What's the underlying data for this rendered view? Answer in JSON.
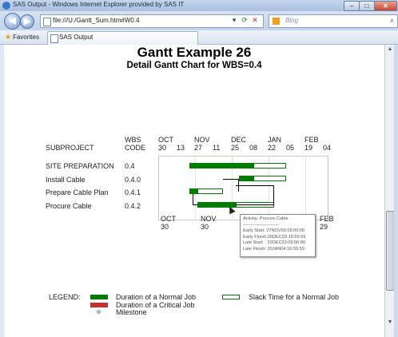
{
  "window": {
    "title": "SAS Output - Windows Internet Explorer provided by SAS IT",
    "minimize": "–",
    "maximize": "□",
    "close": "✕"
  },
  "nav": {
    "url": "file:///U:/Gantt_Sum.htm#W0.4",
    "search_placeholder": "Bing",
    "back": "◀",
    "forward": "▶",
    "refresh": "⟳",
    "stop": "✕",
    "dropdown": "▾",
    "search_icon": "⌕"
  },
  "favorites": {
    "label": "Favorites"
  },
  "tab": {
    "label": "SAS Output"
  },
  "report": {
    "title": "Gantt Example 26",
    "subtitle": "Detail Gantt Chart for WBS=0.4"
  },
  "gantt": {
    "col_headers": {
      "subproject": "SUBPROJECT",
      "wbs_line1": "WBS",
      "wbs_line2": "CODE"
    },
    "months_top": [
      "OCT",
      "NOV",
      "DEC",
      "JAN",
      "FEB"
    ],
    "days_top": [
      "30",
      "13",
      "27",
      "11",
      "25",
      "08",
      "22",
      "05",
      "19",
      "04"
    ],
    "months_bottom": [
      "OCT",
      "NOV",
      "FEB"
    ],
    "days_bottom": [
      "30",
      "30",
      "29"
    ],
    "rows": [
      {
        "subproject": "SITE PREPARATION",
        "wbs": "0.4",
        "normal_start": "27NOV03",
        "normal_end": "02JAN04",
        "slack_end": "23JAN04"
      },
      {
        "subproject": "Install Cable",
        "wbs": "0.4.0",
        "normal_start": "05JAN04",
        "normal_end": "12JAN04",
        "slack_end": "30JAN04"
      },
      {
        "subproject": "Prepare Cable Plan",
        "wbs": "0.4.1",
        "normal_start": "27NOV03",
        "normal_end": "01DEC03",
        "slack_end": "17DEC03"
      },
      {
        "subproject": "Procure Cable",
        "wbs": "0.4.2",
        "normal_start": "27NOV03",
        "normal_end": "26DEC03",
        "slack_end": "20JAN04"
      }
    ],
    "tooltip": {
      "activity": "Activity: Procure Cable",
      "divider": "------------------------",
      "early_start": "Early Start: 27NOV03:09:00:00",
      "early_finish": "Early Finish:26DEC03:16:59:59",
      "late_start": "Late Start:   22DEC03:09:00:00",
      "late_finish": "Late Finish: 20JAN04:16:59:59"
    },
    "colors": {
      "normal": "#007d00",
      "critical": "#c8302c",
      "milestone": "#b8b8b8"
    }
  },
  "legend": {
    "label": "LEGEND:",
    "normal": "Duration of a Normal Job",
    "critical": "Duration of a Critical Job",
    "milestone": "Milestone",
    "slack": "Slack Time for a Normal Job"
  }
}
